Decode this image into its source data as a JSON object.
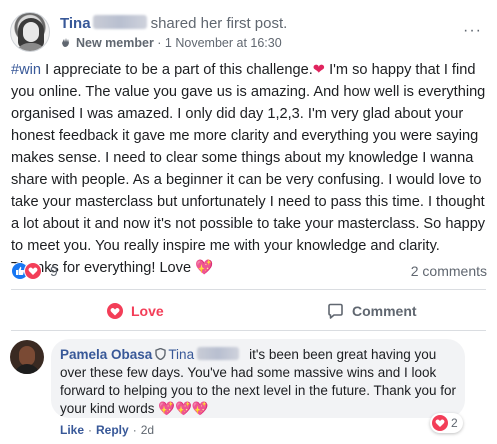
{
  "post": {
    "author_name": "Tina",
    "action_text": "shared her first post.",
    "badge": "New member",
    "timestamp": "· 1 November at 16:30",
    "hashtag": "#win",
    "text_part1": " I appreciate to be a part of this challenge.",
    "text_part2": " I'm so happy that I find you online. The value you gave us is amazing. And how well is everything organised I was amazed. I only did day 1,2,3. I'm very glad about your honest feedback it gave me more clarity and everything you were saying makes sense. I need to clear some things about my knowledge I wanna share with people. As a beginner it can be very confusing. I would love to take your masterclass but unfortunately I need to pass this time. I thought a lot about it and now it's not possible to take your masterclass. So happy to meet you. You really inspire me with your knowledge and clarity. Thanks for everything! Love",
    "heart_emoji": "❤",
    "heart_emoji2": "💖",
    "reaction_count": "9",
    "comments_count": "2 comments"
  },
  "actions": {
    "love_label": "Love",
    "comment_label": "Comment"
  },
  "comment": {
    "author": "Pamela Obasa",
    "tag_name": "Tina",
    "text": "it's been been great having you over these few days. You've had some massive wins and I look forward to helping you to the next level in the future. Thank you for your kind words",
    "emojis": "💖💖💖",
    "reaction_count": "2",
    "like_label": "Like",
    "reply_label": "Reply",
    "age": "2d",
    "sep": "·"
  },
  "colors": {
    "link_blue": "#385898",
    "love_red": "#f33e58",
    "like_blue": "#1877f2",
    "bubble_grey": "#f2f3f5"
  }
}
